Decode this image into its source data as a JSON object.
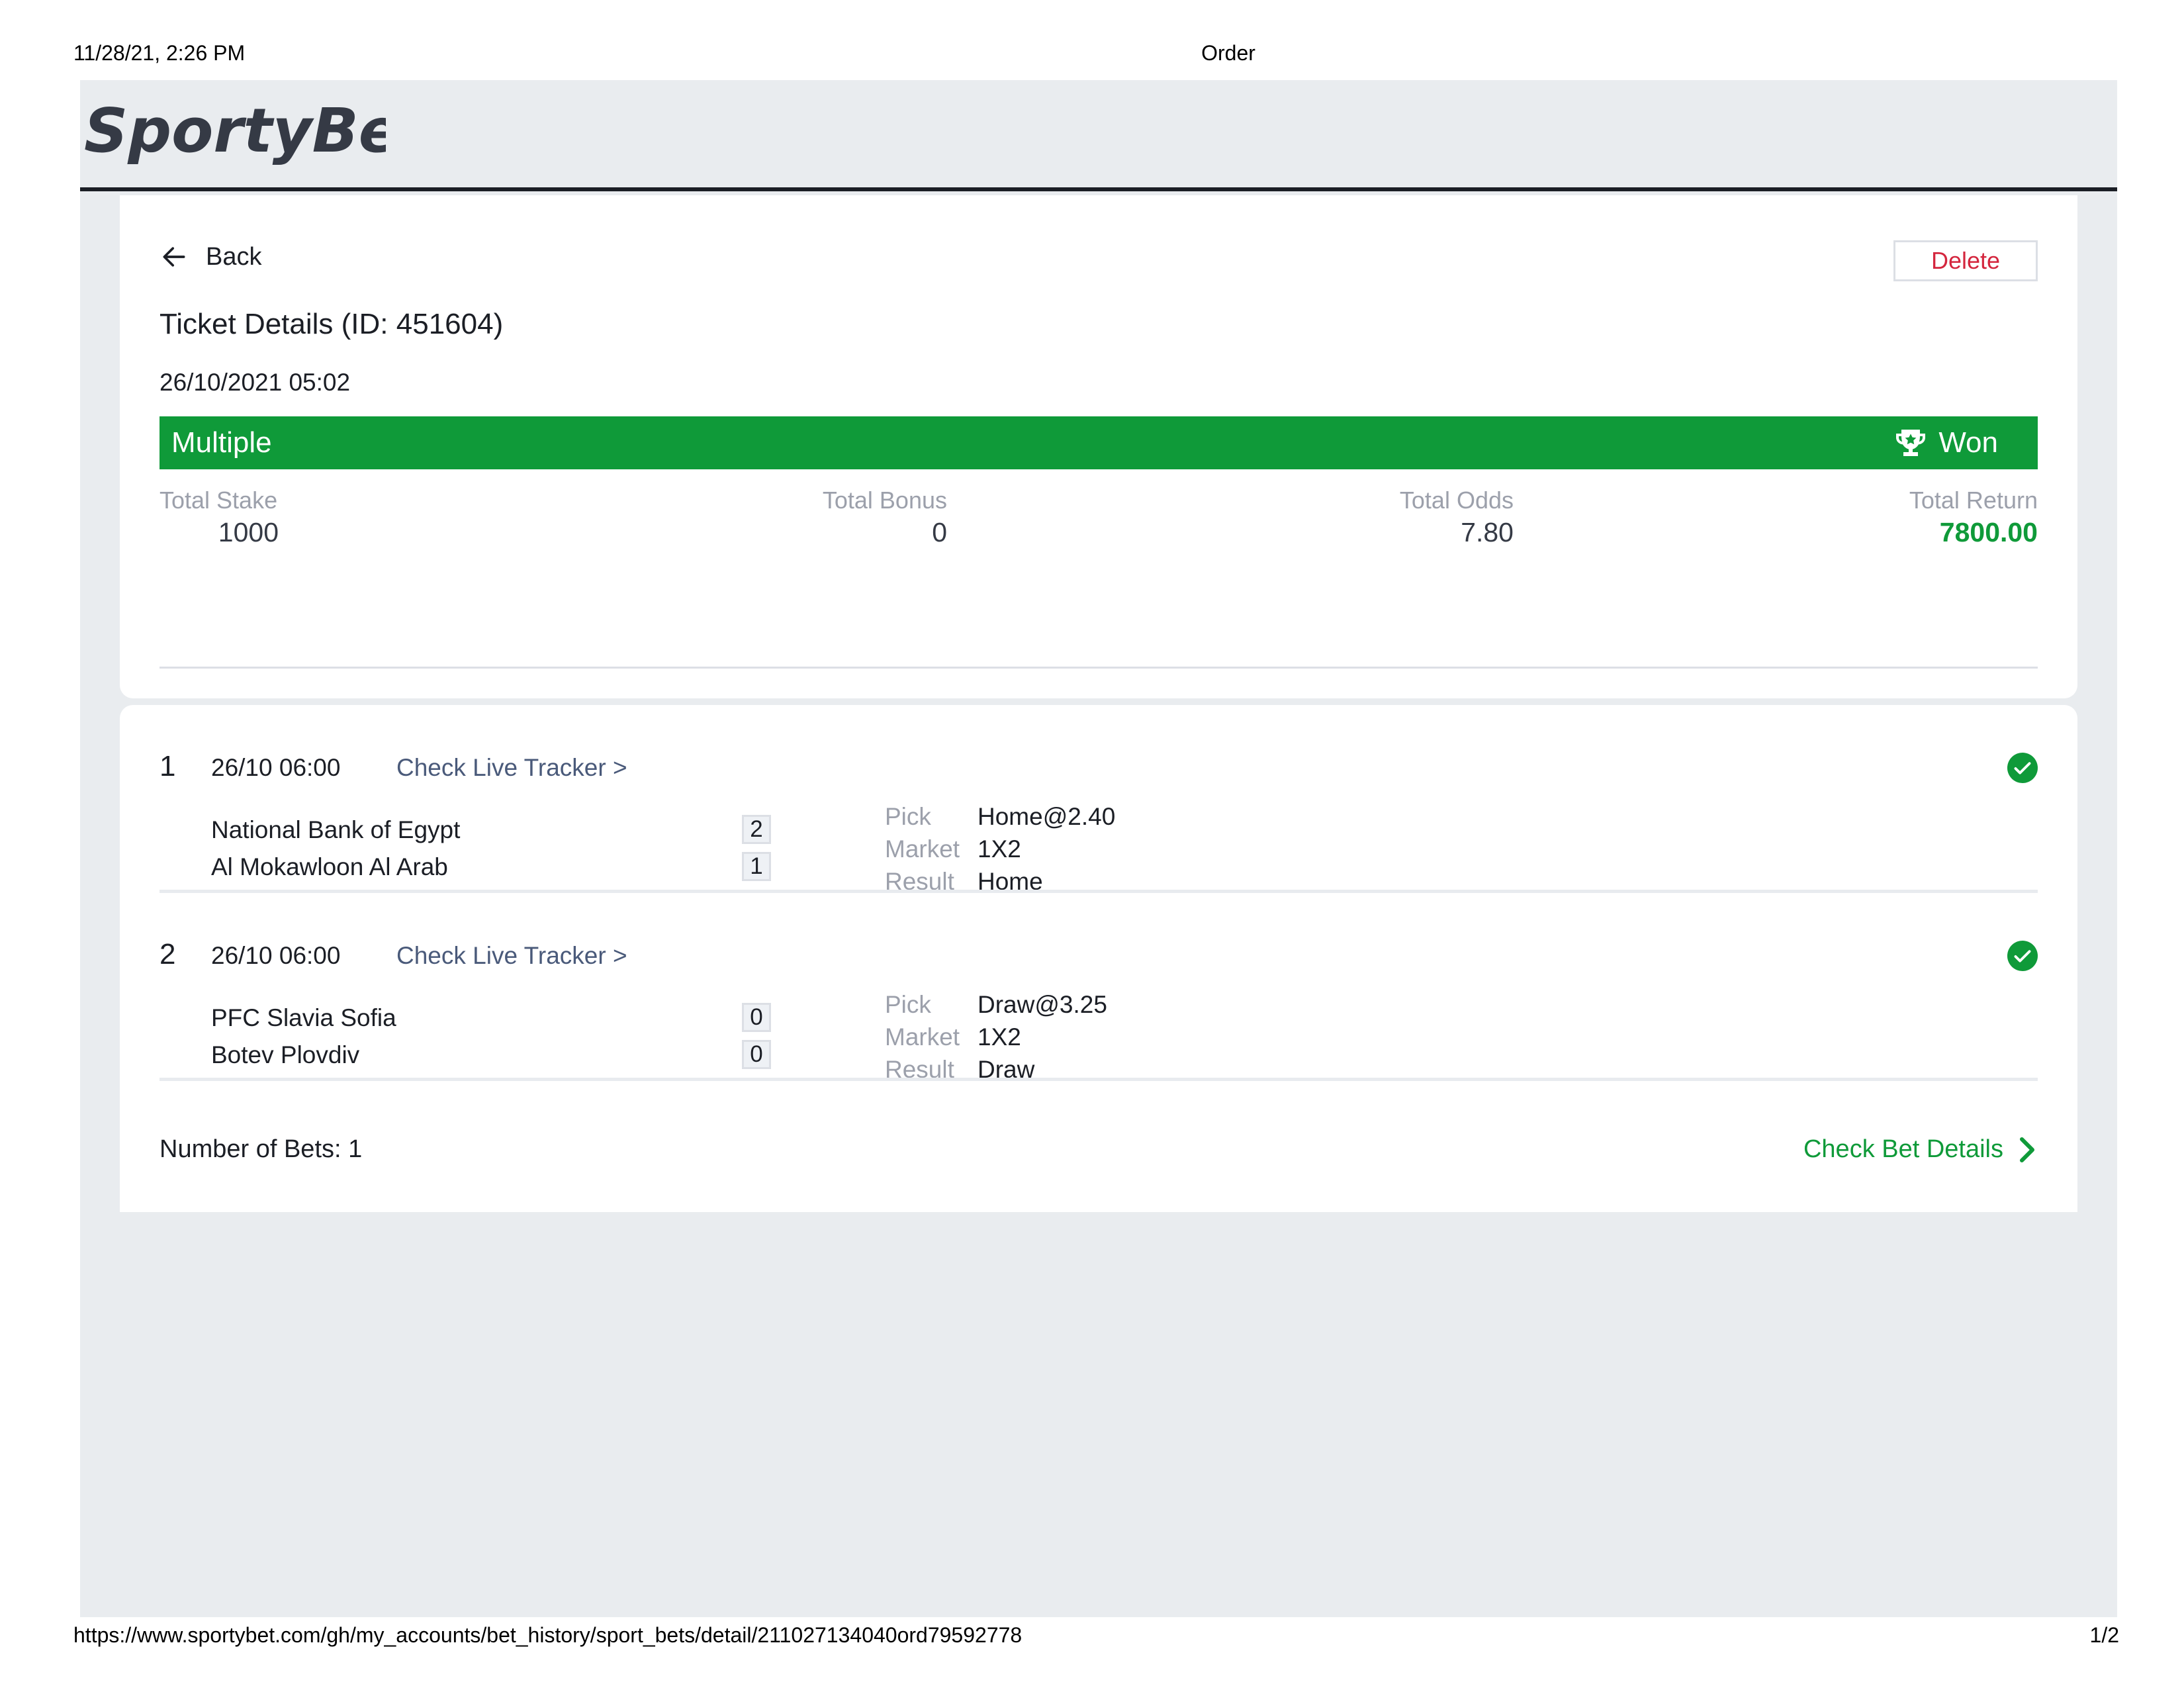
{
  "print": {
    "datetime": "11/28/21, 2:26 PM",
    "page_title": "Order",
    "url": "https://www.sportybet.com/gh/my_accounts/bet_history/sport_bets/detail/211027134040ord79592778",
    "page_number": "1/2"
  },
  "brand": {
    "logo_text": "SportyBet"
  },
  "ticket": {
    "back_label": "Back",
    "delete_label": "Delete",
    "title": "Ticket Details (ID: 451604)",
    "datetime": "26/10/2021 05:02",
    "bet_type": "Multiple",
    "status": "Won",
    "summary": {
      "stake_label": "Total Stake",
      "stake_value": "1000",
      "bonus_label": "Total Bonus",
      "bonus_value": "0",
      "odds_label": "Total Odds",
      "odds_value": "7.80",
      "return_label": "Total Return",
      "return_value": "7800.00"
    }
  },
  "bets": [
    {
      "index": "1",
      "time": "26/10 06:00",
      "tracker_label": "Check Live Tracker >",
      "home_team": "National Bank of Egypt",
      "home_score": "2",
      "away_team": "Al Mokawloon Al Arab",
      "away_score": "1",
      "pick_label": "Pick",
      "pick_value": "Home@2.40",
      "market_label": "Market",
      "market_value": "1X2",
      "result_label": "Result",
      "result_value": "Home"
    },
    {
      "index": "2",
      "time": "26/10 06:00",
      "tracker_label": "Check Live Tracker >",
      "home_team": "PFC Slavia Sofia",
      "home_score": "0",
      "away_team": "Botev Plovdiv",
      "away_score": "0",
      "pick_label": "Pick",
      "pick_value": "Draw@3.25",
      "market_label": "Market",
      "market_value": "1X2",
      "result_label": "Result",
      "result_value": "Draw"
    }
  ],
  "footer": {
    "num_bets": "Number of Bets: 1",
    "check_details_label": "Check Bet Details"
  },
  "colors": {
    "brand_green": "#0f9a39",
    "delete_red": "#d4263e",
    "page_bg": "#e9ecef",
    "dark": "#1b1e25"
  },
  "icons": [
    "back-arrow-icon",
    "trophy-icon",
    "check-circle-icon",
    "chevron-right-icon"
  ]
}
